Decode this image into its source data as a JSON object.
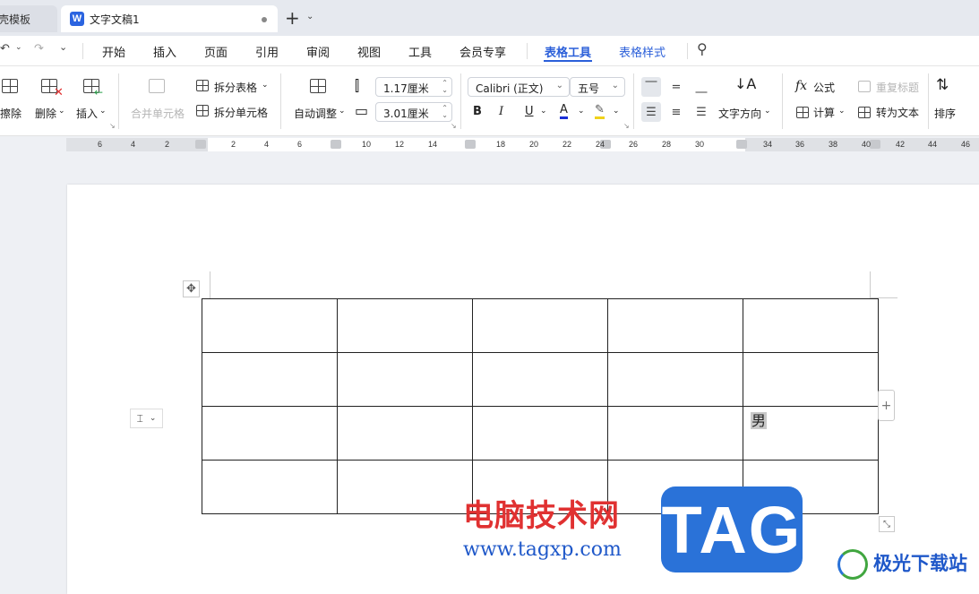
{
  "tabs": [
    {
      "label": "壳模板"
    },
    {
      "label": "文字文稿1",
      "icon": "W"
    }
  ],
  "menubar": {
    "items": [
      "开始",
      "插入",
      "页面",
      "引用",
      "审阅",
      "视图",
      "工具",
      "会员专享",
      "表格工具",
      "表格样式"
    ],
    "selected": "表格工具"
  },
  "ribbon": {
    "erase": "擦除",
    "delete": "删除",
    "insert": "插入",
    "merge_cells": "合并单元格",
    "split_table": "拆分表格",
    "split_cells": "拆分单元格",
    "auto_adjust": "自动调整",
    "row_height": "1.17厘米",
    "col_width": "3.01厘米",
    "font_name": "Calibri (正文)",
    "font_size": "五号",
    "text_direction": "文字方向",
    "formula": "公式",
    "calculate": "计算",
    "repeat_header": "重复标题",
    "convert_to_text": "转为文本",
    "sort": "排序"
  },
  "ruler": {
    "labels": [
      "6",
      "4",
      "2",
      "2",
      "4",
      "6",
      "10",
      "12",
      "14",
      "18",
      "20",
      "22",
      "24",
      "26",
      "28",
      "30",
      "34",
      "36",
      "38",
      "40",
      "42",
      "44",
      "46"
    ]
  },
  "table": {
    "rows": [
      [
        "",
        "",
        "",
        "",
        ""
      ],
      [
        "",
        "",
        "",
        "",
        ""
      ],
      [
        "",
        "",
        "",
        "",
        "男"
      ],
      [
        "",
        "",
        "",
        "",
        ""
      ]
    ]
  },
  "watermarks": {
    "title": "电脑技术网",
    "url": "www.tagxp.com",
    "tag": "TAG",
    "site": "极光下载站"
  },
  "colors": {
    "accent": "#2b5fd9",
    "watermark_red": "#e03131",
    "watermark_blue": "#2a72d8"
  }
}
